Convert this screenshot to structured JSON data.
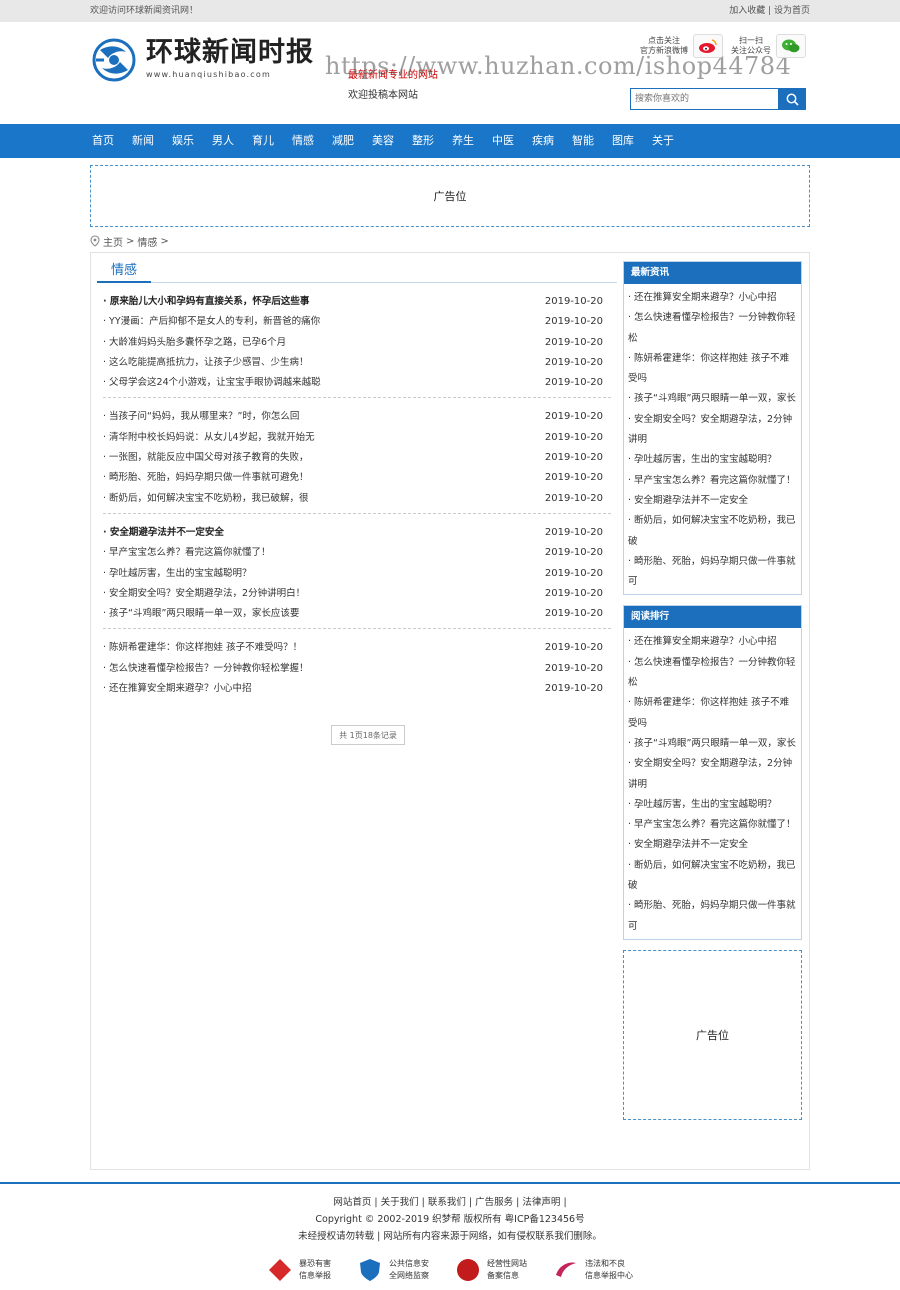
{
  "topbar": {
    "welcome": "欢迎访问环球新闻资讯网！",
    "bookmark": "加入收藏",
    "sep": " | ",
    "homepage": "设为首页"
  },
  "header": {
    "logo_cn": "环球新闻时报",
    "logo_en": "www.huanqiushibao.com",
    "slogan": "最新新闻专业的网站",
    "welcome": "欢迎投稿本网站",
    "watermark": "https://www.huzhan.com/ishop44784",
    "weibo_text": [
      "点击关注",
      "官方新浪微博"
    ],
    "wechat_text": [
      "扫一扫",
      "关注公众号"
    ],
    "search_placeholder": "搜索你喜欢的"
  },
  "nav": [
    "首页",
    "新闻",
    "娱乐",
    "男人",
    "育儿",
    "情感",
    "减肥",
    "美容",
    "整形",
    "养生",
    "中医",
    "疾病",
    "智能",
    "图库",
    "关于"
  ],
  "ad_top": "广告位",
  "breadcrumb": {
    "home": "主页",
    "sep": ">",
    "category": "情感"
  },
  "category_title": "情感",
  "article_groups": [
    [
      {
        "title": "原来胎儿大小和孕妈有直接关系，怀孕后这些事",
        "date": "2019-10-20",
        "bold": true
      },
      {
        "title": "YY漫画：产后抑郁不是女人的专利，新晋爸的痛你",
        "date": "2019-10-20"
      },
      {
        "title": "大龄准妈妈头胎多囊怀孕之路，已孕6个月",
        "date": "2019-10-20"
      },
      {
        "title": "这么吃能提高抵抗力，让孩子少感冒、少生病！",
        "date": "2019-10-20"
      },
      {
        "title": "父母学会这24个小游戏，让宝宝手眼协调越来越聪",
        "date": "2019-10-20"
      }
    ],
    [
      {
        "title": "当孩子问“妈妈，我从哪里来？”时，你怎么回",
        "date": "2019-10-20"
      },
      {
        "title": "清华附中校长妈妈说：从女儿4岁起，我就开始无",
        "date": "2019-10-20"
      },
      {
        "title": "一张图，就能反应中国父母对孩子教育的失败，",
        "date": "2019-10-20"
      },
      {
        "title": "畸形胎、死胎，妈妈孕期只做一件事就可避免！",
        "date": "2019-10-20"
      },
      {
        "title": "断奶后，如何解决宝宝不吃奶粉，我已破解，很",
        "date": "2019-10-20"
      }
    ],
    [
      {
        "title": "安全期避孕法并不一定安全",
        "date": "2019-10-20",
        "bold": true
      },
      {
        "title": "早产宝宝怎么养？看完这篇你就懂了！",
        "date": "2019-10-20"
      },
      {
        "title": "孕吐越厉害，生出的宝宝越聪明？",
        "date": "2019-10-20"
      },
      {
        "title": "安全期安全吗？安全期避孕法，2分钟讲明白！",
        "date": "2019-10-20"
      },
      {
        "title": "孩子“斗鸡眼”两只眼睛一单一双，家长应该要",
        "date": "2019-10-20"
      }
    ],
    [
      {
        "title": "陈妍希霍建华：你这样抱娃 孩子不难受吗？！",
        "date": "2019-10-20"
      },
      {
        "title": "怎么快速看懂孕检报告？一分钟教你轻松掌握！",
        "date": "2019-10-20"
      },
      {
        "title": "还在推算安全期来避孕？小心中招",
        "date": "2019-10-20"
      }
    ]
  ],
  "pager": "共 1页18条记录",
  "sidebar": {
    "latest_title": "最新资讯",
    "latest": [
      "还在推算安全期来避孕？小心中招",
      "怎么快速看懂孕检报告？一分钟教你轻松",
      "陈妍希霍建华：你这样抱娃 孩子不难受吗",
      "孩子“斗鸡眼”两只眼睛一单一双，家长",
      "安全期安全吗？安全期避孕法，2分钟讲明",
      "孕吐越厉害，生出的宝宝越聪明？",
      "早产宝宝怎么养？看完这篇你就懂了！",
      "安全期避孕法并不一定安全",
      "断奶后，如何解决宝宝不吃奶粉，我已破",
      "畸形胎、死胎，妈妈孕期只做一件事就可"
    ],
    "rank_title": "阅读排行",
    "rank": [
      "还在推算安全期来避孕？小心中招",
      "怎么快速看懂孕检报告？一分钟教你轻松",
      "陈妍希霍建华：你这样抱娃 孩子不难受吗",
      "孩子“斗鸡眼”两只眼睛一单一双，家长",
      "安全期安全吗？安全期避孕法，2分钟讲明",
      "孕吐越厉害，生出的宝宝越聪明？",
      "早产宝宝怎么养？看完这篇你就懂了！",
      "安全期避孕法并不一定安全",
      "断奶后，如何解决宝宝不吃奶粉，我已破",
      "畸形胎、死胎，妈妈孕期只做一件事就可"
    ],
    "ad": "广告位"
  },
  "footer": {
    "links": [
      "网站首页",
      "关于我们",
      "联系我们",
      "广告服务",
      "法律声明"
    ],
    "copyright": "Copyright © 2002-2019 织梦帮 版权所有 粤ICP备123456号",
    "notice": "未经授权请勿转载 | 网站所有内容来源于网络，如有侵权联系我们删除。",
    "badges": [
      {
        "line1": "暴恐有害",
        "line2": "信息举报",
        "icon": "report-diamond-icon",
        "color": "#d62a2a"
      },
      {
        "line1": "公共信息安",
        "line2": "全网络监察",
        "icon": "police-shield-icon",
        "color": "#1b6fbd"
      },
      {
        "line1": "经营性网站",
        "line2": "备案信息",
        "icon": "record-badge-icon",
        "color": "#c21b1b"
      },
      {
        "line1": "违法和不良",
        "line2": "信息举报中心",
        "icon": "report-center-icon",
        "color": "#c4255a"
      }
    ]
  }
}
